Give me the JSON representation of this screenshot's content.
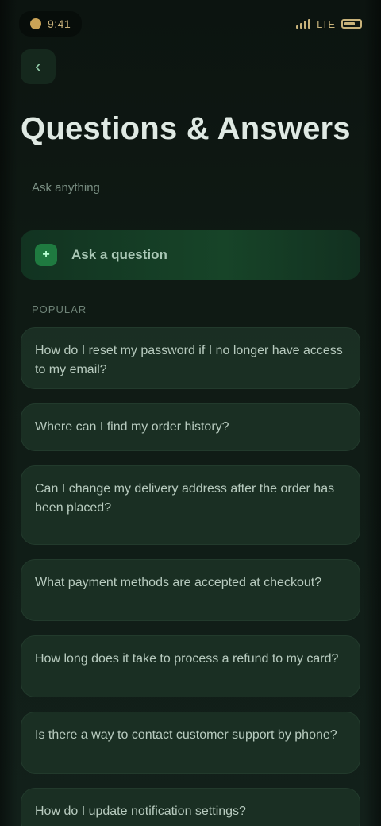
{
  "status_bar": {
    "time": "9:41",
    "network": "LTE"
  },
  "header": {
    "back_icon": "chevron-left-icon",
    "title": "Questions & Answers",
    "subtitle": "Ask anything"
  },
  "cta": {
    "icon": "plus-icon",
    "label": "Ask a question"
  },
  "section": {
    "label": "Popular"
  },
  "questions": [
    "How do I reset my password if I no longer have access to my email?",
    "Where can I find my order history?",
    "Can I change my delivery address after the order has been placed?",
    "What payment methods are accepted at checkout?",
    "How long does it take to process a refund to my card?",
    "Is there a way to contact customer support by phone?",
    "How do I update notification settings?"
  ]
}
